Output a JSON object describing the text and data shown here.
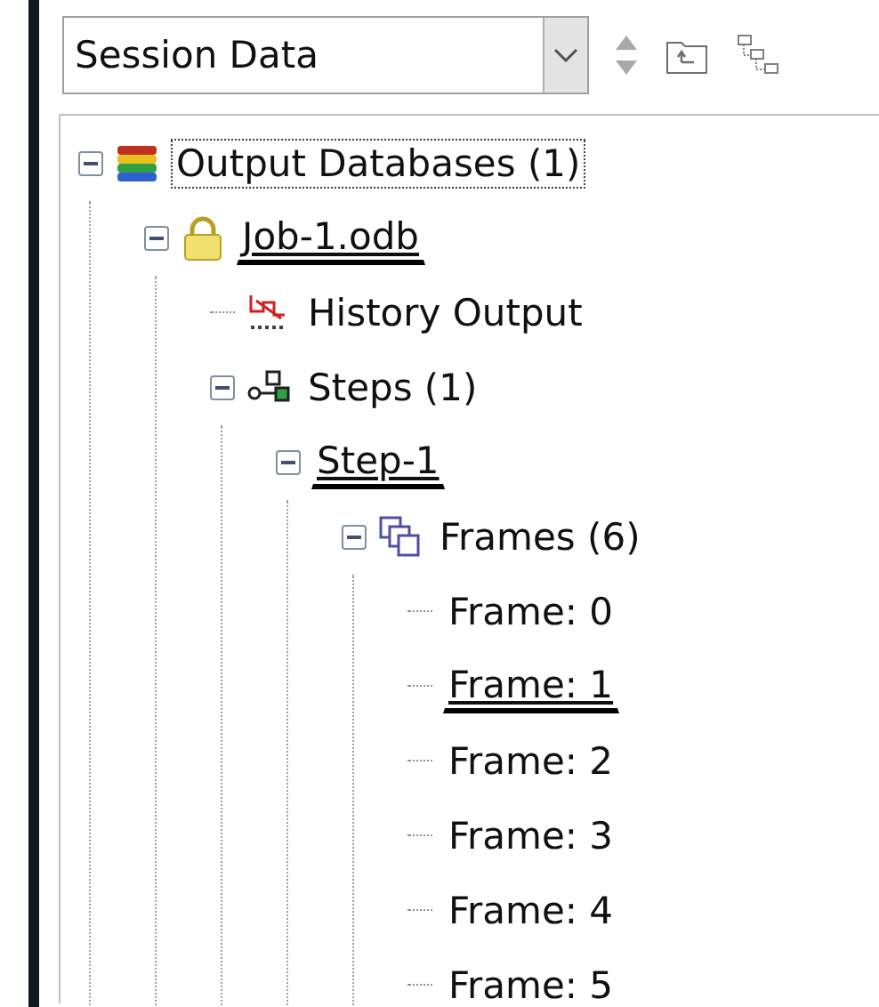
{
  "session_combo": {
    "value": "Session Data"
  },
  "tree": [
    {
      "label": "Output Databases (1)",
      "kind": "database",
      "expanded": true,
      "marked": false,
      "focused": true,
      "children": [
        {
          "label": "Job-1.odb",
          "kind": "odb",
          "expanded": true,
          "marked": true,
          "focused": false,
          "children": [
            {
              "label": "History Output",
              "kind": "history",
              "expanded": false,
              "marked": false,
              "focused": false
            },
            {
              "label": "Steps (1)",
              "kind": "steps",
              "expanded": true,
              "marked": false,
              "focused": false,
              "children": [
                {
                  "label": "Step-1",
                  "expanded": true,
                  "marked": true,
                  "focused": false,
                  "children": [
                    {
                      "label": "Frames (6)",
                      "kind": "frames",
                      "expanded": true,
                      "marked": false,
                      "focused": false,
                      "children": [
                        {
                          "label": "Frame: 0",
                          "expanded": false,
                          "marked": false,
                          "focused": false
                        },
                        {
                          "label": "Frame: 1",
                          "expanded": false,
                          "marked": true,
                          "focused": false
                        },
                        {
                          "label": "Frame: 2",
                          "expanded": false,
                          "marked": false,
                          "focused": false
                        },
                        {
                          "label": "Frame: 3",
                          "expanded": false,
                          "marked": false,
                          "focused": false
                        },
                        {
                          "label": "Frame: 4",
                          "expanded": false,
                          "marked": false,
                          "focused": false
                        },
                        {
                          "label": "Frame: 5",
                          "expanded": false,
                          "marked": false,
                          "focused": false
                        }
                      ]
                    }
                  ]
                }
              ]
            }
          ]
        }
      ]
    }
  ]
}
